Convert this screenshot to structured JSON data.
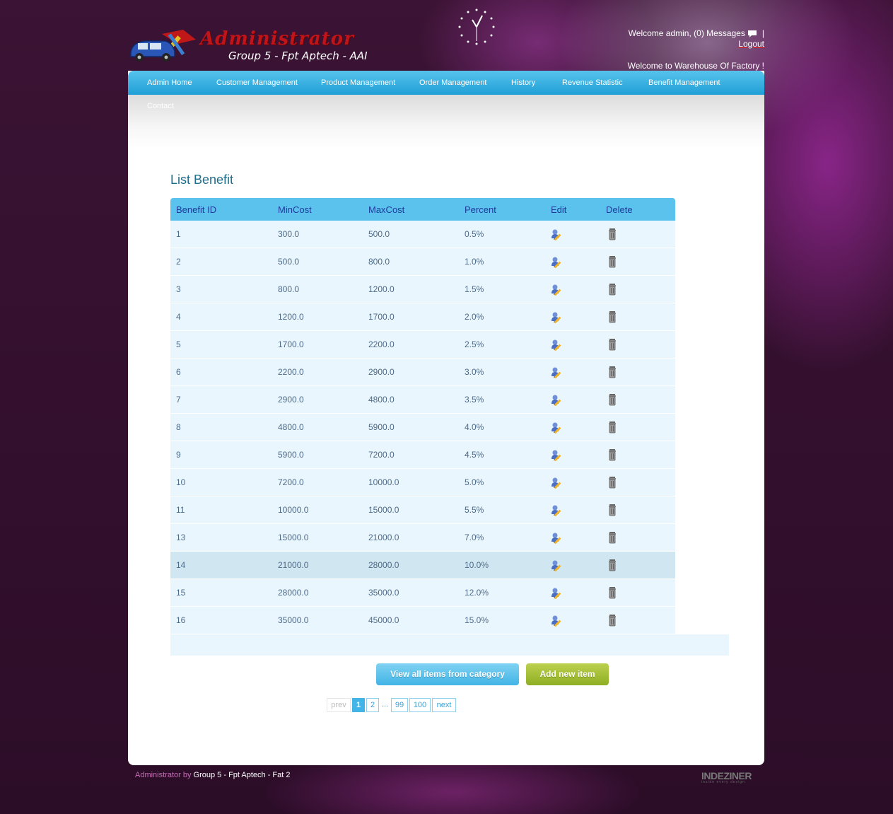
{
  "header": {
    "logo_title": "Administrator",
    "logo_subtitle": "Group 5 - Fpt Aptech - AAI",
    "welcome_user": "Welcome admin,",
    "messages_link": "(0) Messages",
    "separator": "|",
    "logout_link": "Logout",
    "welcome_site": "Welcome to Warehouse Of Factory !"
  },
  "nav": {
    "items": [
      {
        "label": "Admin Home"
      },
      {
        "label": "Customer Management"
      },
      {
        "label": "Product Management"
      },
      {
        "label": "Order Management"
      },
      {
        "label": "History"
      },
      {
        "label": "Revenue Statistic"
      },
      {
        "label": "Benefit Management"
      }
    ],
    "second_row": [
      {
        "label": "Contact"
      }
    ]
  },
  "main": {
    "title": "List Benefit",
    "columns": [
      "Benefit ID",
      "MinCost",
      "MaxCost",
      "Percent",
      "Edit",
      "Delete"
    ],
    "rows": [
      {
        "id": "1",
        "min": "300.0",
        "max": "500.0",
        "percent": "0.5%"
      },
      {
        "id": "2",
        "min": "500.0",
        "max": "800.0",
        "percent": "1.0%"
      },
      {
        "id": "3",
        "min": "800.0",
        "max": "1200.0",
        "percent": "1.5%"
      },
      {
        "id": "4",
        "min": "1200.0",
        "max": "1700.0",
        "percent": "2.0%"
      },
      {
        "id": "5",
        "min": "1700.0",
        "max": "2200.0",
        "percent": "2.5%"
      },
      {
        "id": "6",
        "min": "2200.0",
        "max": "2900.0",
        "percent": "3.0%"
      },
      {
        "id": "7",
        "min": "2900.0",
        "max": "4800.0",
        "percent": "3.5%"
      },
      {
        "id": "8",
        "min": "4800.0",
        "max": "5900.0",
        "percent": "4.0%"
      },
      {
        "id": "9",
        "min": "5900.0",
        "max": "7200.0",
        "percent": "4.5%"
      },
      {
        "id": "10",
        "min": "7200.0",
        "max": "10000.0",
        "percent": "5.0%"
      },
      {
        "id": "11",
        "min": "10000.0",
        "max": "15000.0",
        "percent": "5.5%"
      },
      {
        "id": "13",
        "min": "15000.0",
        "max": "21000.0",
        "percent": "7.0%"
      },
      {
        "id": "14",
        "min": "21000.0",
        "max": "28000.0",
        "percent": "10.0%",
        "selected": true
      },
      {
        "id": "15",
        "min": "28000.0",
        "max": "35000.0",
        "percent": "12.0%"
      },
      {
        "id": "16",
        "min": "35000.0",
        "max": "45000.0",
        "percent": "15.0%"
      }
    ],
    "view_all_button": "View all items from category",
    "add_button": "Add new item"
  },
  "pager": {
    "prev": "prev",
    "pages": [
      "1",
      "2"
    ],
    "ellipsis": "...",
    "last_pages": [
      "99",
      "100"
    ],
    "next": "next",
    "current": "1"
  },
  "footer": {
    "prefix": "Administrator by",
    "credit": "Group 5 - Fpt Aptech - Fat 2",
    "brand": "INDEZINER",
    "brand_tag": "inside every design"
  },
  "colors": {
    "nav_blue": "#1f9fd6",
    "header_row": "#5bc2ee",
    "row_bg": "#eaf6fd",
    "selected_row": "#d0e6f0",
    "add_green": "#8eae22",
    "page_bg": "#3a1232"
  },
  "icons": {
    "edit": "edit-user-pencil-icon",
    "delete": "trash-can-icon",
    "messages": "speech-bubble-icon",
    "clock": "clock-icon"
  }
}
